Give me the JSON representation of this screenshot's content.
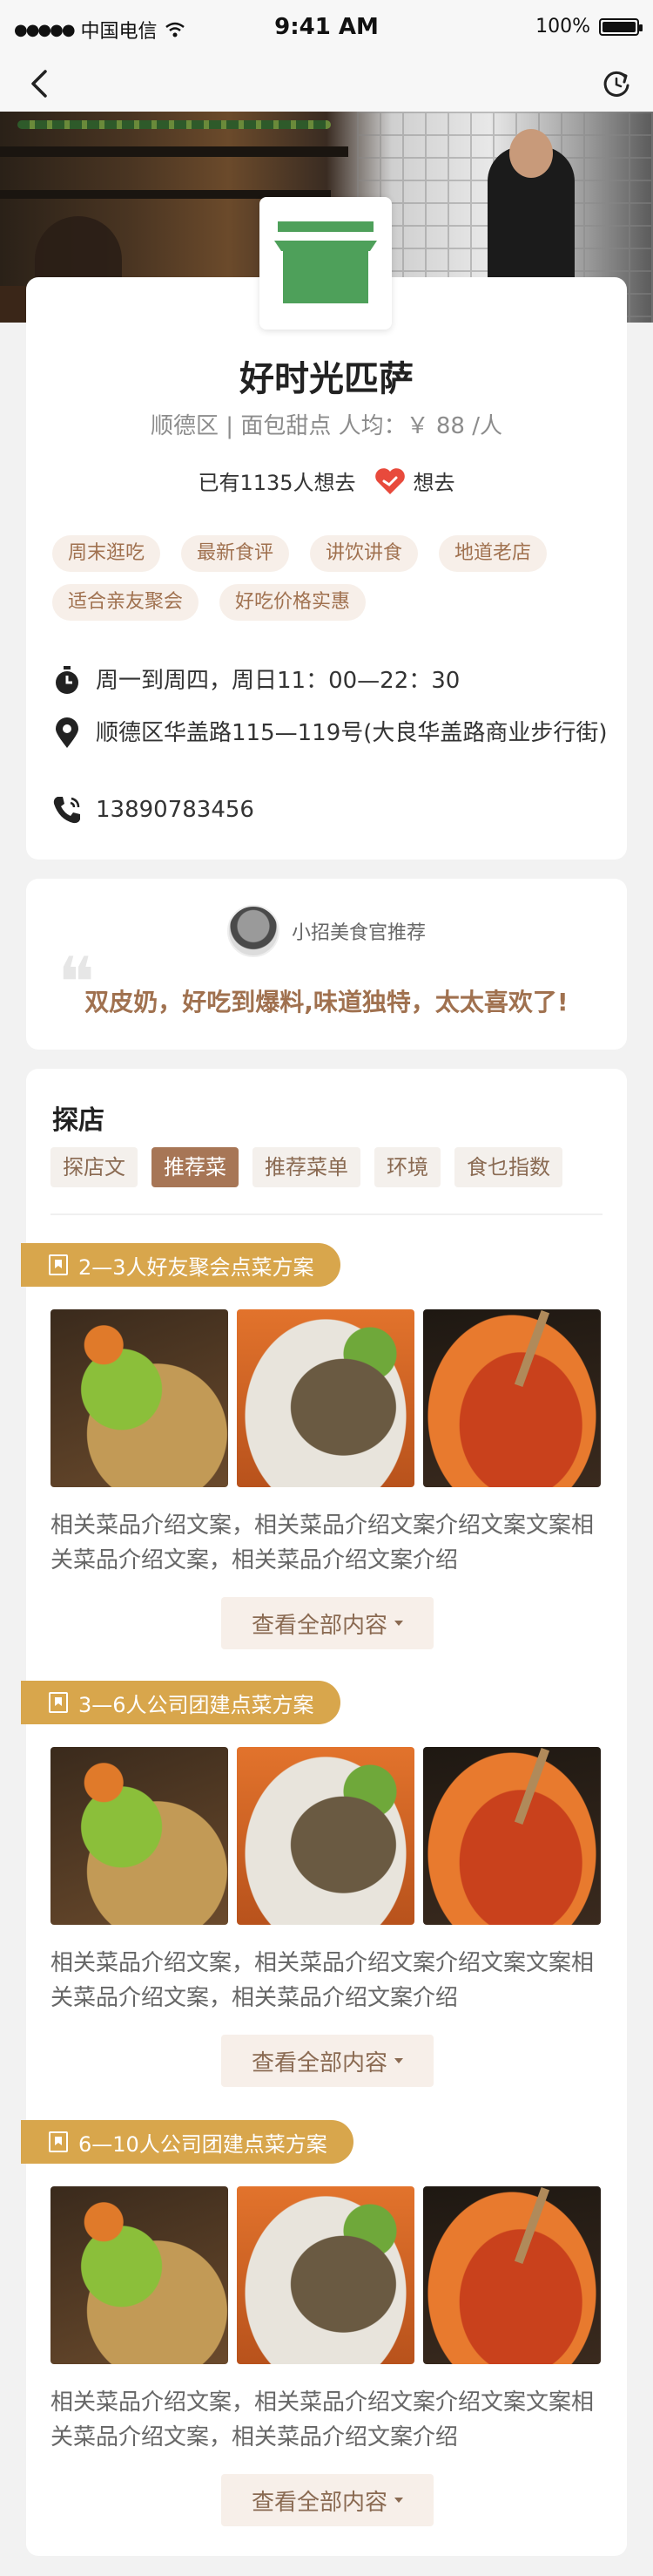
{
  "status_bar": {
    "carrier": "中国电信",
    "time": "9:41 AM",
    "battery": "100%",
    "battery_level": 1.0
  },
  "nav": {
    "back_icon": "chevron-left-icon",
    "refresh_icon": "refresh-icon"
  },
  "shop": {
    "name": "好时光匹萨",
    "meta": "顺德区 | 面包甜点   人均：￥ 88 /人",
    "want_count": "已有1135人想去",
    "want_label": "想去",
    "logo_color": "#4ea05a",
    "tags": [
      "周末逛吃",
      "最新食评",
      "讲饮讲食",
      "地道老店",
      "适合亲友聚会",
      "好吃价格实惠"
    ],
    "hours": "周一到周四，周日11：00—22：30",
    "address": "顺德区华盖路115—119号(大良华盖路商业步行街)",
    "phone": "13890783456"
  },
  "recommend": {
    "title": "小招美食官推荐",
    "quote": "双皮奶，好吃到爆料,味道独特，太太喜欢了!"
  },
  "explore": {
    "title": "探店",
    "tabs": [
      {
        "label": "探店文",
        "active": false
      },
      {
        "label": "推荐菜",
        "active": true
      },
      {
        "label": "推荐菜单",
        "active": false
      },
      {
        "label": "环境",
        "active": false
      },
      {
        "label": "食乜指数",
        "active": false
      }
    ],
    "sections": [
      {
        "title": "2—3人好友聚会点菜方案",
        "desc": "相关菜品介绍文案，相关菜品介绍文案介绍文案文案相关菜品介绍文案，相关菜品介绍文案介绍",
        "more": "查看全部内容"
      },
      {
        "title": "3—6人公司团建点菜方案",
        "desc": "相关菜品介绍文案，相关菜品介绍文案介绍文案文案相关菜品介绍文案，相关菜品介绍文案介绍",
        "more": "查看全部内容"
      },
      {
        "title": "6—10人公司团建点菜方案",
        "desc": "相关菜品介绍文案，相关菜品介绍文案介绍文案文案相关菜品介绍文案，相关菜品介绍文案介绍",
        "more": "查看全部内容"
      }
    ]
  },
  "colors": {
    "accent": "#a77656",
    "ribbon": "#d8a64c",
    "tag_bg": "#f7efe9",
    "heart": "#e84a3c"
  }
}
